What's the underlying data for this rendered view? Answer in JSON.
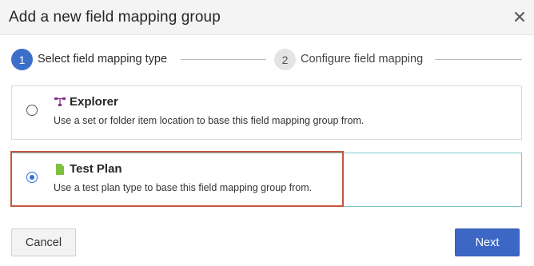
{
  "dialog": {
    "title": "Add a new field mapping group",
    "close_icon": "close-icon"
  },
  "steps": [
    {
      "number": "1",
      "label": "Select field mapping type",
      "state": "active"
    },
    {
      "number": "2",
      "label": "Configure field mapping",
      "state": "inactive"
    }
  ],
  "options": [
    {
      "title": "Explorer",
      "description": "Use a set or folder item location to base this field mapping group from.",
      "icon": "explorer-tree-icon",
      "icon_color": "#8a2f8f",
      "selected": false
    },
    {
      "title": "Test Plan",
      "description": "Use a test plan type to base this field mapping group from.",
      "icon": "test-plan-document-icon",
      "icon_color": "#7fbf3f",
      "selected": true
    }
  ],
  "footer": {
    "cancel_label": "Cancel",
    "next_label": "Next"
  },
  "colors": {
    "accent": "#3c67c5",
    "highlight": "#c8553d",
    "selected_border": "#7ec8c8"
  }
}
